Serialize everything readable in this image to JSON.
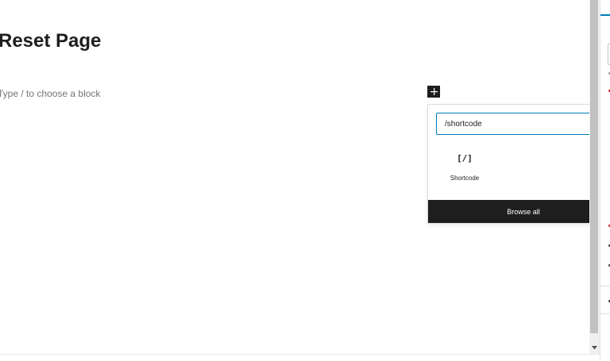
{
  "editor": {
    "page_title": "Reset Page",
    "block_placeholder": "Type / to choose a block"
  },
  "inserter": {
    "search_value": "/shortcode",
    "results": [
      {
        "icon_text": "[/]",
        "label": "Shortcode"
      }
    ],
    "browse_all_label": "Browse all"
  },
  "icons": {
    "toggle": "plus-icon",
    "clear": "close-icon",
    "block": "shortcode-icon",
    "scroll": "scroll-down-arrow-icon"
  },
  "colors": {
    "accent": "#007cba",
    "dark": "#1e1e1e",
    "placeholder": "#757575"
  }
}
